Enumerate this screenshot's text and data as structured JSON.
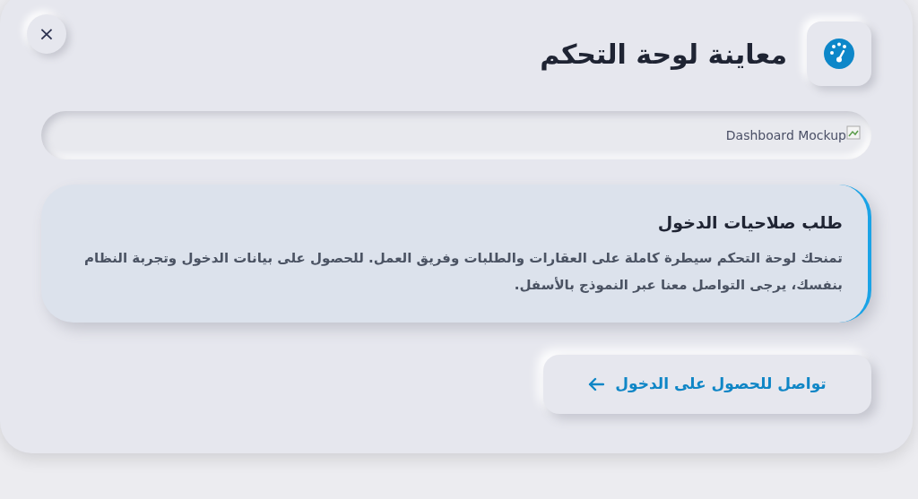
{
  "close_button": {
    "label": "×"
  },
  "header": {
    "title": "معاينة لوحة التحكم"
  },
  "preview": {
    "alt_text": "Dashboard Mockup"
  },
  "notice": {
    "title": "طلب صلاحيات الدخول",
    "body": "تمنحك لوحة التحكم سيطرة كاملة على العقارات والطلبات وفريق العمل. للحصول على بيانات الدخول وتجربة النظام بنفسك، يرجى التواصل معنا عبر النموذج بالأسفل."
  },
  "contact_button": {
    "label": "تواصل للحصول على الدخول"
  }
}
